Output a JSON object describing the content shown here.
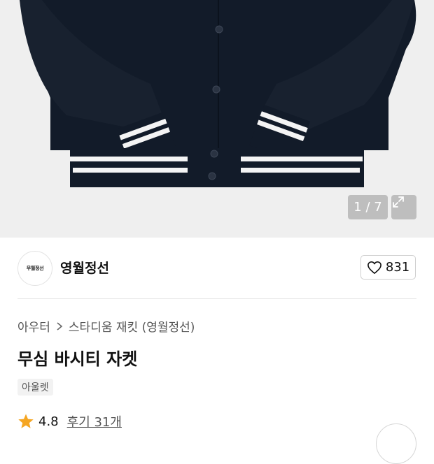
{
  "gallery": {
    "counter": "1 / 7",
    "expand_icon": "expand-icon"
  },
  "store": {
    "logo_text": "무월정선",
    "name": "영월정선",
    "like_icon": "heart-icon",
    "like_count": "831"
  },
  "product": {
    "breadcrumb": [
      "아우터",
      "스타디움 재킷 (영월정선)"
    ],
    "breadcrumb_separator_icon": "chevron-right-icon",
    "title": "무심 바시티 자켓",
    "tag": "아울렛",
    "rating": "4.8",
    "review_label": "후기 31개"
  },
  "colors": {
    "jacket": "#111a28",
    "stripe": "#f4f4f4",
    "star": "#f5a623",
    "background": "#efefef"
  }
}
